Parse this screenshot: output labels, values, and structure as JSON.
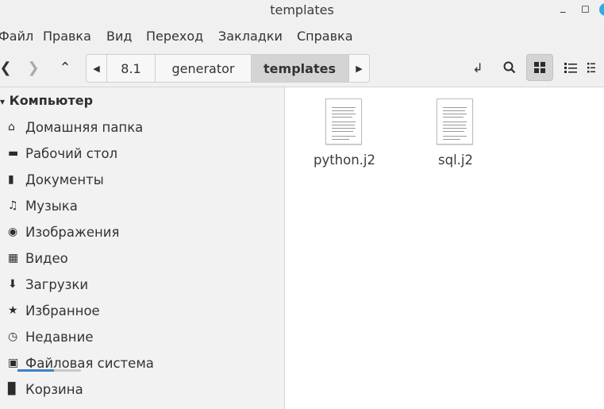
{
  "window": {
    "title": "templates"
  },
  "menubar": {
    "items": [
      "Файл",
      "Правка",
      "Вид",
      "Переход",
      "Закладки",
      "Справка"
    ]
  },
  "breadcrumbs": [
    "8.1",
    "generator",
    "templates"
  ],
  "sidebar": {
    "header": "Компьютер",
    "items": [
      {
        "label": "Домашняя папка",
        "icon": "home-icon"
      },
      {
        "label": "Рабочий стол",
        "icon": "desktop-icon"
      },
      {
        "label": "Документы",
        "icon": "document-icon"
      },
      {
        "label": "Музыка",
        "icon": "music-icon"
      },
      {
        "label": "Изображения",
        "icon": "camera-icon"
      },
      {
        "label": "Видео",
        "icon": "film-icon"
      },
      {
        "label": "Загрузки",
        "icon": "download-icon"
      },
      {
        "label": "Избранное",
        "icon": "star-icon"
      },
      {
        "label": "Недавние",
        "icon": "clock-icon"
      },
      {
        "label": "Файловая система",
        "icon": "drive-icon"
      },
      {
        "label": "Корзина",
        "icon": "trash-icon"
      }
    ]
  },
  "files": [
    {
      "name": "python.j2",
      "type": "text-file-icon"
    },
    {
      "name": "sql.j2",
      "type": "text-file-icon"
    }
  ],
  "accent_color": "#3aa7e4"
}
